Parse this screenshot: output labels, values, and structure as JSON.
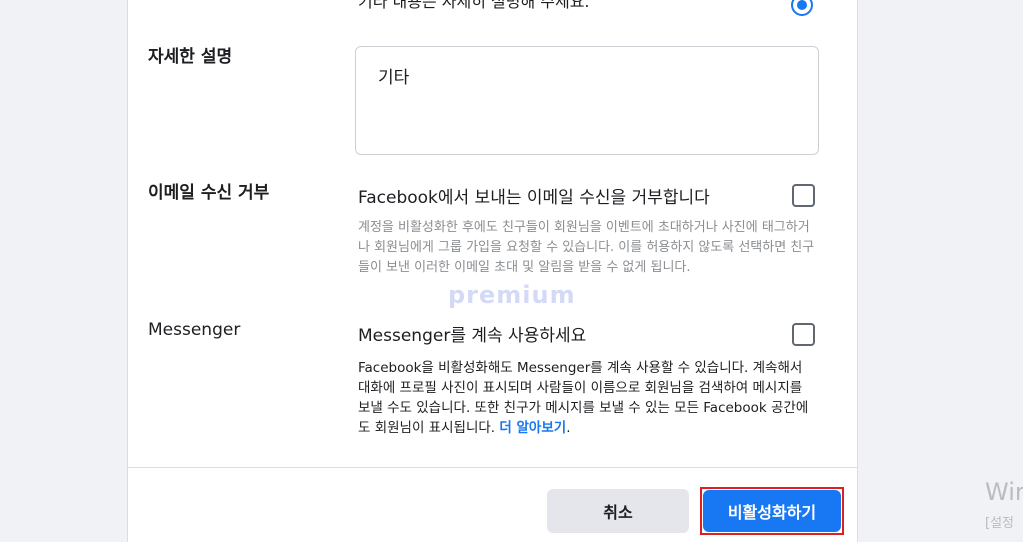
{
  "top_partial_text": "기타 내용은 자세히 설명해 주세요.",
  "detail": {
    "label": "자세한 설명",
    "textarea_value": "기타"
  },
  "email_optout": {
    "label": "이메일 수신 거부",
    "option_title": "Facebook에서 보내는 이메일 수신을 거부합니다",
    "description": "계정을 비활성화한 후에도 친구들이 회원님을 이벤트에 초대하거나 사진에 태그하거나 회원님에게 그룹 가입을 요청할 수 있습니다. 이를 허용하지 않도록 선택하면 친구들이 보낸 이러한 이메일 초대 및 알림을 받을 수 없게 됩니다.",
    "checked": false
  },
  "messenger": {
    "label": "Messenger",
    "option_title": "Messenger를 계속 사용하세요",
    "description": "Facebook을 비활성화해도 Messenger를 계속 사용할 수 있습니다. 계속해서 대화에 프로필 사진이 표시되며 사람들이 이름으로 회원님을 검색하여 메시지를 보낼 수도 있습니다. 또한 친구가 메시지를 보낼 수 있는 모든 Facebook 공간에도 회원님이 표시됩니다.",
    "learn_more": "더 알아보기",
    "trailing": ".",
    "checked": false
  },
  "watermark": "premium",
  "buttons": {
    "cancel": "취소",
    "deactivate": "비활성화하기"
  },
  "os_overlay": {
    "title": "Wir",
    "subtitle": "[설정"
  },
  "colors": {
    "primary": "#1877f2",
    "highlight_border": "#e02020"
  }
}
